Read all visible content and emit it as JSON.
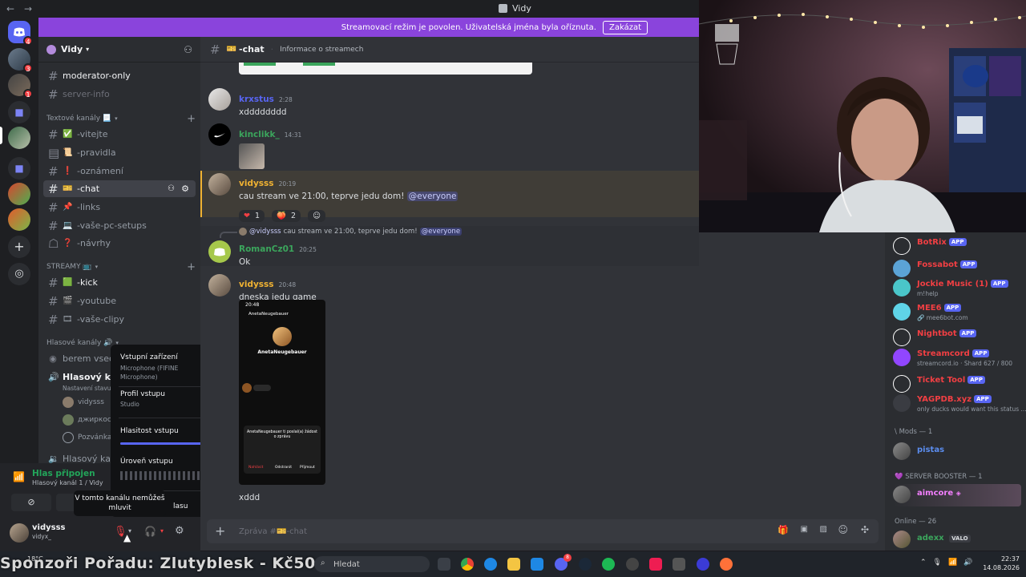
{
  "window": {
    "title": "Vidy"
  },
  "streamer_banner": {
    "text": "Streamovací režim je povolen. Uživatelská jména byla oříznuta.",
    "button": "Zakázat"
  },
  "rail": {
    "badges": [
      "4",
      "3",
      "1"
    ]
  },
  "server": {
    "name": "Vidy"
  },
  "sidebar": {
    "top_channels": [
      {
        "name": "moderator-only",
        "unread": true
      },
      {
        "name": "server-info",
        "unread": false
      }
    ],
    "categories": {
      "text": "Textové kanály 📃",
      "streams": "STREAMY 📺",
      "voice": "Hlasové kanály 🔊"
    },
    "text_channels": [
      {
        "emoji": "✅",
        "name": "-vitejte"
      },
      {
        "emoji": "📜",
        "name": "-pravidla"
      },
      {
        "emoji": "❗",
        "name": "-oznámení"
      },
      {
        "emoji": "🎫",
        "name": "-chat"
      },
      {
        "emoji": "📌",
        "name": "-links"
      },
      {
        "emoji": "💻",
        "name": "-vaše-pc-setups"
      },
      {
        "emoji": "❓",
        "name": "-návrhy"
      }
    ],
    "stream_channels": [
      {
        "emoji": "🟩",
        "name": "-kick"
      },
      {
        "emoji": "🎬",
        "name": "-youtube"
      },
      {
        "emoji": "🎞",
        "name": "-vaše-clipy"
      }
    ],
    "voice_channels": [
      {
        "name": "berem vsechn"
      },
      {
        "name": "Hlasový kanál"
      },
      {
        "name": "Hlasový kanál"
      }
    ],
    "voice_status": "Nastavení stavu k",
    "voice_users": [
      "vidysss",
      "джиркос",
      "Pozvánka"
    ]
  },
  "voice_panel": {
    "title": "Hlas připojen",
    "subtitle": "Hlasový kanál 1 / Vidy"
  },
  "user_panel": {
    "name": "vidysss",
    "tag": "vidyx_"
  },
  "input_menu": {
    "device_label": "Vstupní zařízení",
    "device_value": "Microphone (FIFINE Microphone)",
    "profile_label": "Profil vstupu",
    "profile_value": "Studio",
    "volume_label": "Hlasitost vstupu",
    "volume_level": 0.95,
    "level_label": "Úroveň vstupu",
    "tail_text": "lasu"
  },
  "tooltip": "V tomto kanálu nemůžeš mluvit",
  "chat": {
    "channel": "-chat",
    "channel_emoji": "🎫",
    "topic": "Informace o streamech",
    "messages": [
      {
        "user": "krxstus",
        "time": "2:28",
        "text": "xdddddddd",
        "color": "#5865f2"
      },
      {
        "user": "kinclikk_",
        "time": "14:31",
        "text": "",
        "color": "#3ba55c"
      },
      {
        "user": "vidysss",
        "time": "20:19",
        "text": "cau stream ve 21:00, teprve jedu dom!",
        "mention": "@everyone",
        "color": "#f0b232",
        "reactions": [
          {
            "emoji": "❤",
            "count": "1"
          },
          {
            "emoji": "🍑",
            "count": "2"
          }
        ]
      },
      {
        "reply_to": "@vidysss",
        "reply_text": "cau stream ve 21:00, teprve jedu dom!",
        "reply_mention": "@everyone",
        "user": "RomanCz01",
        "time": "20:25",
        "text": "Ok",
        "color": "#3ba55c"
      },
      {
        "user": "vidysss",
        "time": "20:48",
        "text": "dneska jedu game",
        "color": "#f0b232"
      },
      {
        "text": "xddd"
      }
    ],
    "phone_screenshot": {
      "time": "20:48",
      "profile_name": "AnetaNeugebauer",
      "card_title": "AnetaNeugebauer ti poslal(a) žádost o zprávu",
      "actions": [
        "Nahlásit",
        "Odstranit",
        "Přijmout"
      ]
    },
    "composer_placeholder": "Zpráva #🎫-chat"
  },
  "members": {
    "bots": [
      {
        "name": "BotRix",
        "sub": ""
      },
      {
        "name": "Fossabot",
        "sub": ""
      },
      {
        "name": "Jockie Music (1)",
        "sub": "m!help"
      },
      {
        "name": "MEE6",
        "sub": "🔗 mee6bot.com"
      },
      {
        "name": "Nightbot",
        "sub": ""
      },
      {
        "name": "Streamcord",
        "sub": "streamcord.io · Shard 627 / 800"
      },
      {
        "name": "Ticket Tool",
        "sub": ""
      },
      {
        "name": "YAGPDB.xyz",
        "sub": "only ducks would want this status ..."
      }
    ],
    "app_label": "APP",
    "mods_header": "\\ Mods — 1",
    "mods": [
      "pistas"
    ],
    "booster_header": "💜 SERVER BOOSTER — 1",
    "boosters": [
      "aimcore"
    ],
    "online_header": "Online — 26",
    "online": [
      {
        "name": "adexx",
        "tag": "VALO"
      }
    ]
  },
  "taskbar": {
    "sponsor": "Sponzoři Pořadu: Zlutyblesk - Kč50",
    "weather": "18°C",
    "search": "Hledat",
    "time": "22:37",
    "date": "14.08.2026",
    "notif_badge": "8"
  },
  "colors": {
    "accent": "#8a44dc",
    "bot": "#f23f43",
    "mention": "#5865f2"
  }
}
